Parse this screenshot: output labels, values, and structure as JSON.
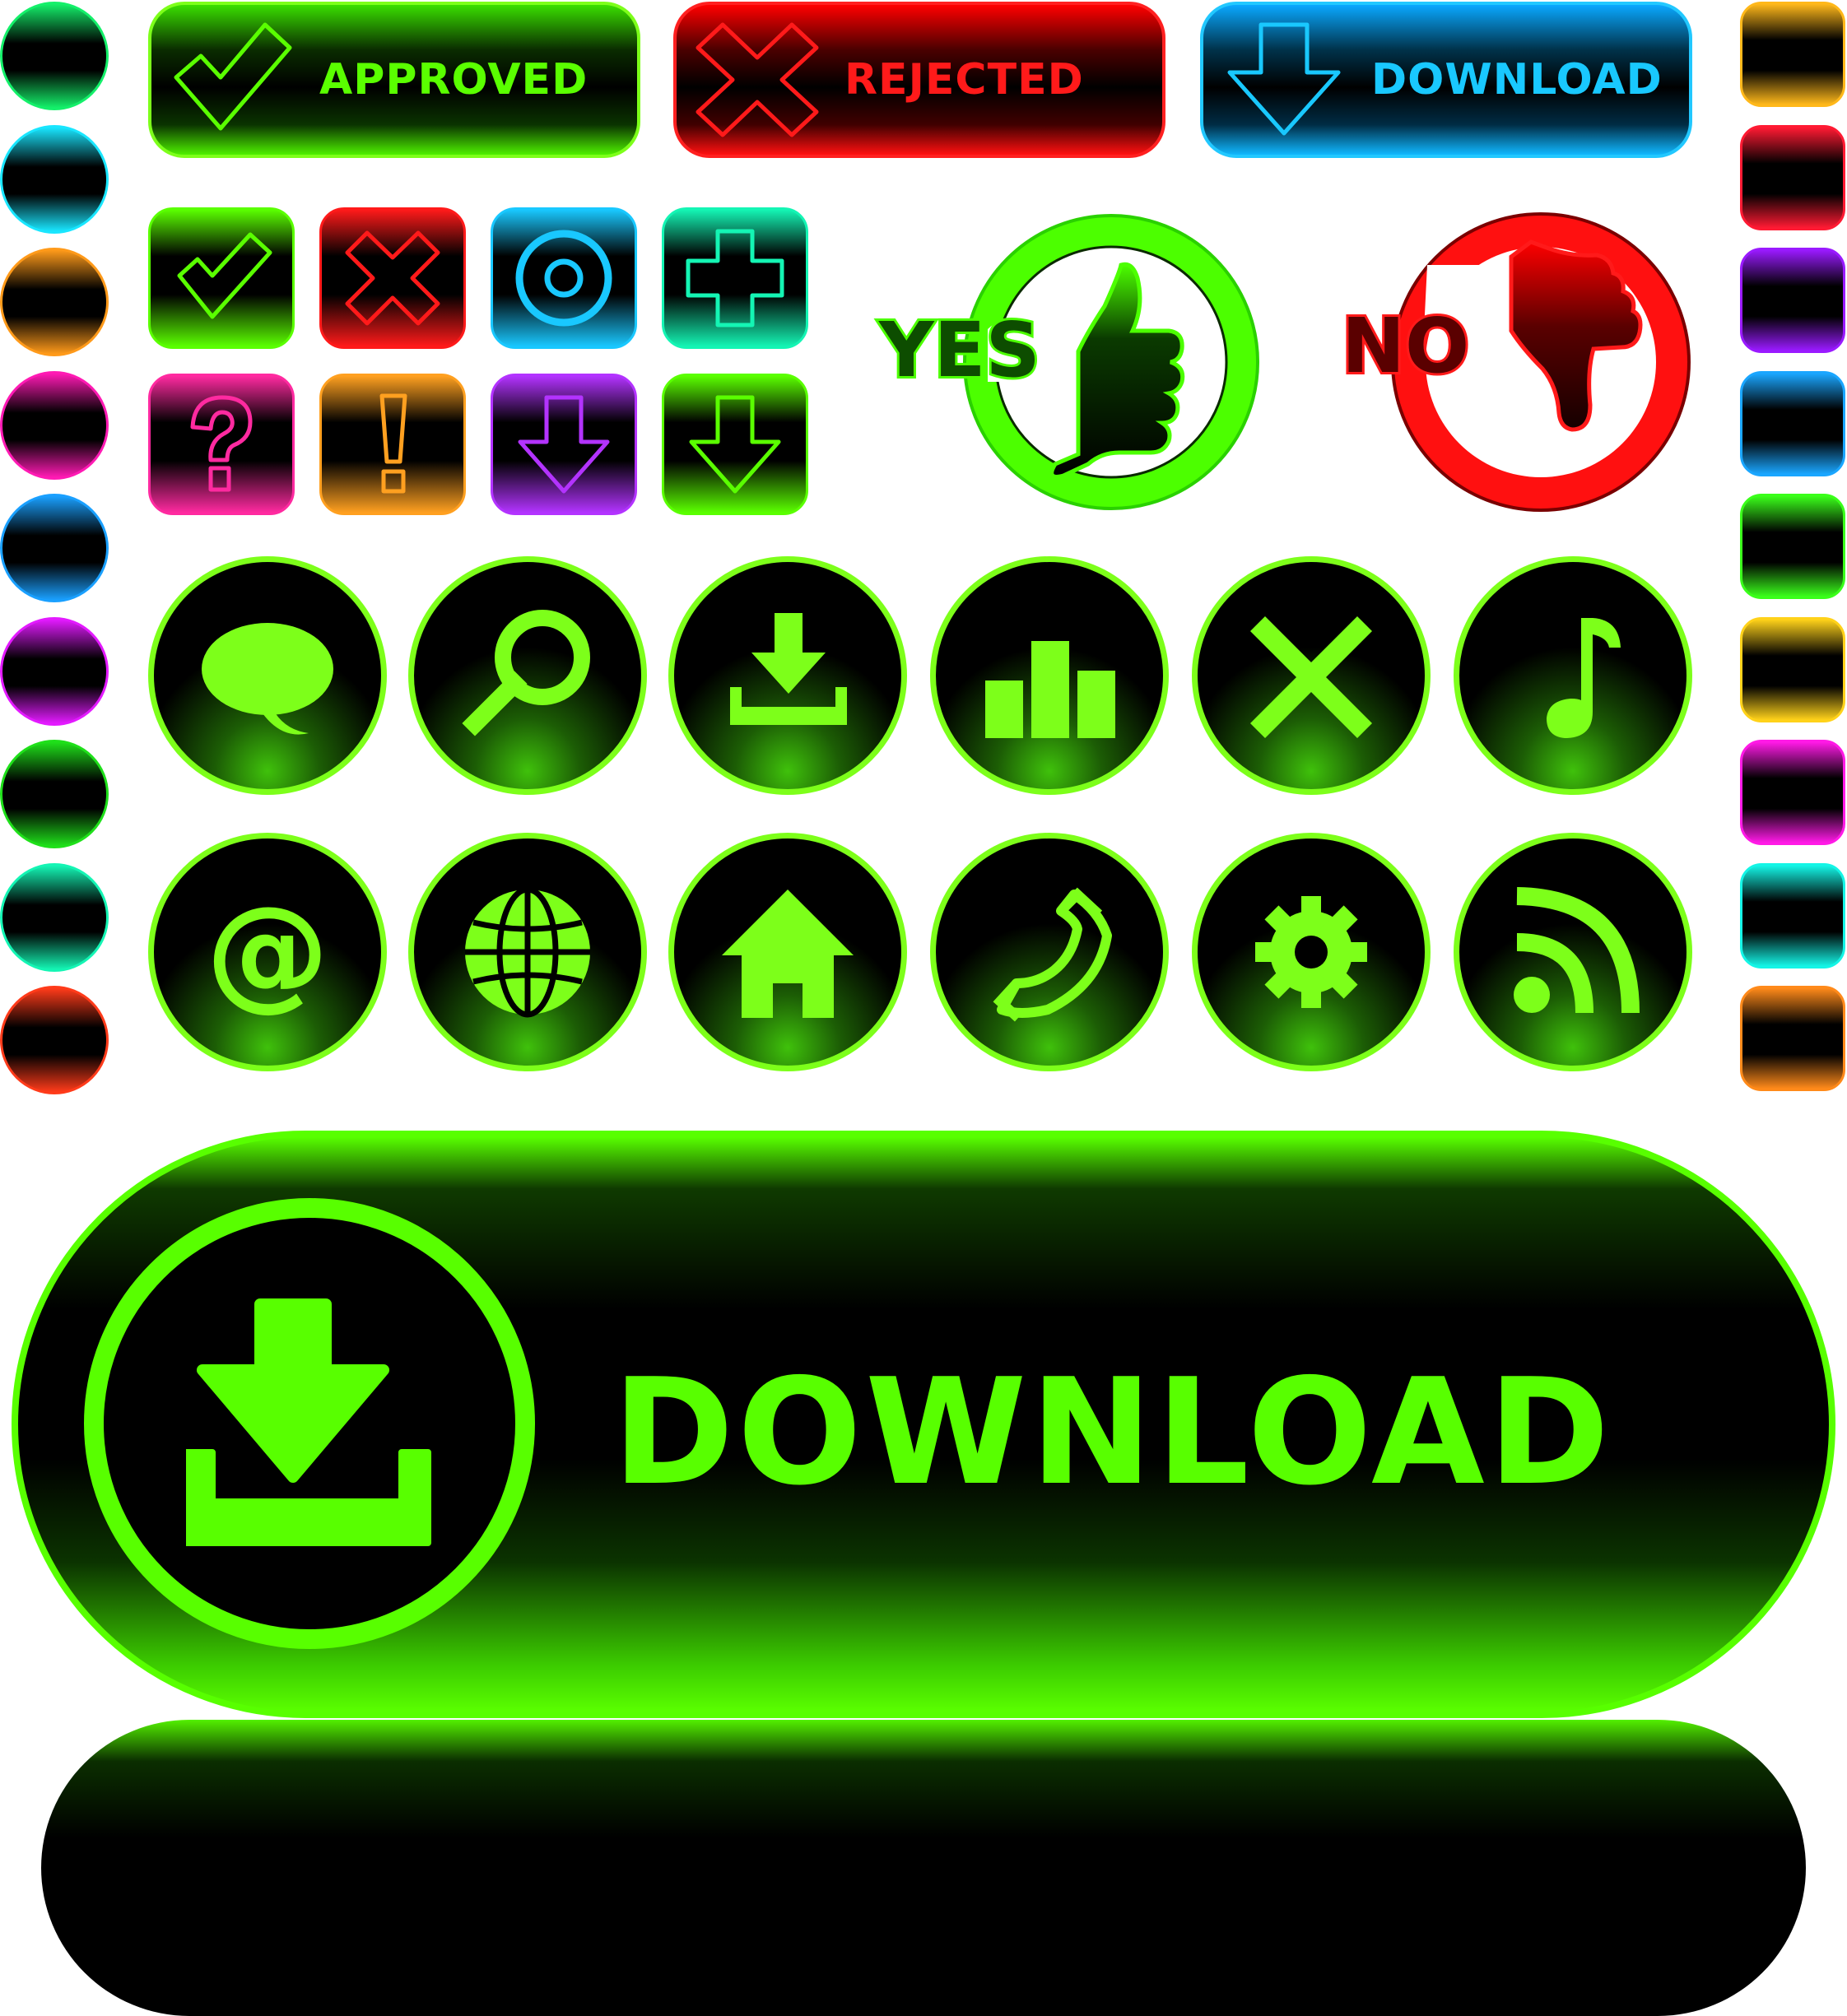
{
  "colors": {
    "green": "#5aff00",
    "red": "#ff1a1a",
    "blue": "#19c8ff",
    "teal": "#14f5b4",
    "pink": "#ff2aa0",
    "orange": "#ffa020",
    "purple": "#b333ff"
  },
  "left_dots": [
    {
      "color": "#14f06a"
    },
    {
      "color": "#19e6ff"
    },
    {
      "color": "#ff9a1a"
    },
    {
      "color": "#ff1ab4"
    },
    {
      "color": "#1aa0ff"
    },
    {
      "color": "#e31aff"
    },
    {
      "color": "#1fe01a"
    },
    {
      "color": "#14f5b4"
    },
    {
      "color": "#ff3b1a"
    }
  ],
  "right_squares": [
    {
      "color": "#ffb81a"
    },
    {
      "color": "#ff1a33"
    },
    {
      "color": "#9a1aff"
    },
    {
      "color": "#1aa6ff"
    },
    {
      "color": "#3aff1a"
    },
    {
      "color": "#ffd21a"
    },
    {
      "color": "#ff1ae6"
    },
    {
      "color": "#14f5e6"
    },
    {
      "color": "#ff8a1a"
    }
  ],
  "top_buttons": {
    "approved": {
      "label": "APPROVED",
      "icon": "check-icon"
    },
    "rejected": {
      "label": "REJECTED",
      "icon": "x-icon"
    },
    "download": {
      "label": "DOWNLOAD",
      "icon": "arrow-down-icon"
    }
  },
  "tiles": [
    {
      "icon": "check-icon",
      "color": "#5aff00"
    },
    {
      "icon": "x-icon",
      "color": "#ff1a1a"
    },
    {
      "icon": "target-icon",
      "color": "#19c8ff"
    },
    {
      "icon": "plus-icon",
      "color": "#14f5b4"
    },
    {
      "icon": "question-icon",
      "color": "#ff2aa0"
    },
    {
      "icon": "exclamation-icon",
      "color": "#ffa020"
    },
    {
      "icon": "arrow-down-icon",
      "color": "#b333ff"
    },
    {
      "icon": "arrow-down-icon",
      "color": "#5aff00"
    }
  ],
  "yes_no": {
    "yes": "YES",
    "no": "NO"
  },
  "round_icons_row1": [
    "speech-bubble-icon",
    "magnifier-icon",
    "download-tray-icon",
    "bar-chart-icon",
    "close-icon",
    "music-note-icon"
  ],
  "round_icons_row2": [
    "at-sign-icon",
    "globe-icon",
    "home-icon",
    "phone-icon",
    "gear-icon",
    "rss-icon"
  ],
  "at_glyph": "@",
  "big_button": {
    "label": "DOWNLOAD",
    "icon": "download-tray-icon"
  }
}
